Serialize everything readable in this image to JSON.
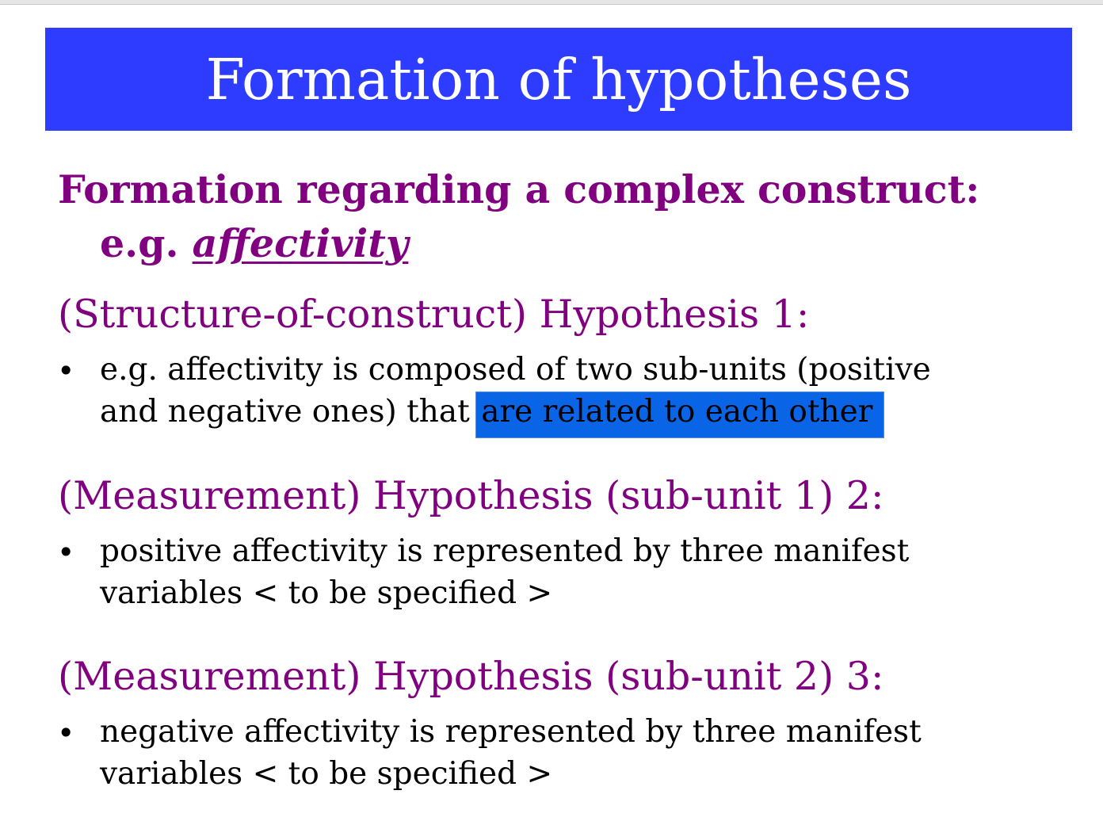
{
  "slide": {
    "title": "Formation of hypotheses",
    "subheading": {
      "line1": "Formation regarding a complex construct:",
      "line2_prefix": "e.g.",
      "line2_emphasis": "affectivity"
    },
    "sections": [
      {
        "heading": "(Structure-of-construct) Hypothesis 1:",
        "bullet": "•",
        "line1": "e.g. affectivity is composed of two sub-units (positive",
        "line2_prefix": "and negative ones) that",
        "line2_highlight": "are related to each other"
      },
      {
        "heading": "(Measurement) Hypothesis (sub-unit 1) 2:",
        "bullet": "•",
        "line1": "positive affectivity is represented by three manifest",
        "line2": "variables < to be specified >"
      },
      {
        "heading": "(Measurement) Hypothesis (sub-unit 2) 3:",
        "bullet": "•",
        "line1": "negative affectivity is represented by three manifest",
        "line2": "variables < to be specified >"
      }
    ]
  },
  "colors": {
    "title_bar": "#2e3cff",
    "title_text": "#ffffff",
    "accent_purple": "#800080",
    "body_text": "#000000",
    "selection_highlight": "#0a64e6"
  }
}
